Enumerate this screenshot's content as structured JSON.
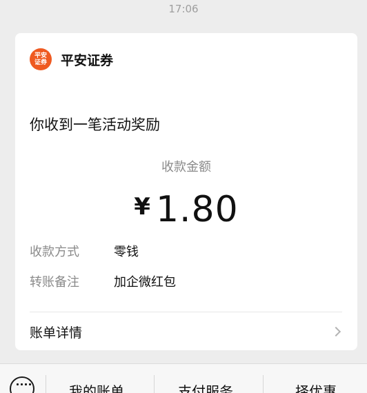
{
  "status_time": "17:06",
  "sender": {
    "name": "平安证券",
    "logo_text": "平安证券",
    "logo_color": "#ef5a21"
  },
  "message": {
    "headline": "你收到一笔活动奖励"
  },
  "payment": {
    "amount_label": "收款金额",
    "currency": "¥",
    "amount": "1.80",
    "method_label": "收款方式",
    "method_value": "零钱",
    "note_label": "转账备注",
    "note_value": "加企微红包"
  },
  "detail_link": {
    "label": "账单详情",
    "icon": "chevron-right-icon"
  },
  "bottom_menu": {
    "keyboard_icon": "keyboard-icon",
    "items": [
      {
        "label": "我的账单"
      },
      {
        "label": "支付服务"
      },
      {
        "label": "择优惠"
      }
    ]
  }
}
